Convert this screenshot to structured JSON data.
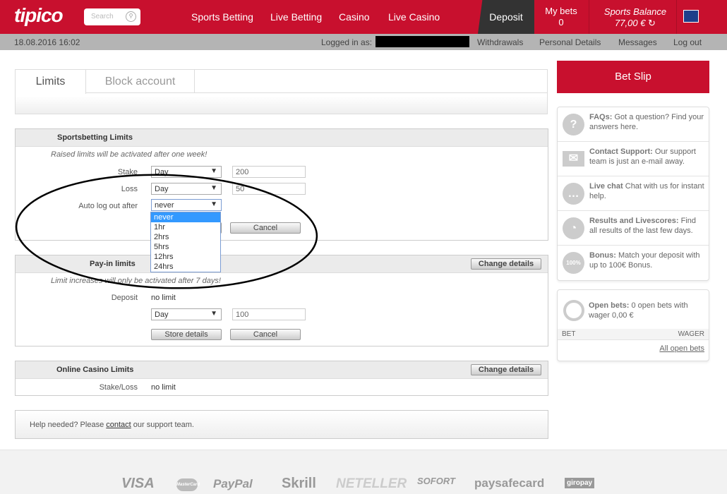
{
  "header": {
    "logo": "tipico",
    "search_placeholder": "Search",
    "nav": [
      "Sports Betting",
      "Live Betting",
      "Casino",
      "Live Casino"
    ],
    "deposit": "Deposit",
    "my_bets_label": "My bets",
    "my_bets_count": "0",
    "balance_label": "Sports Balance",
    "balance_value": "77,00 €",
    "brand_color": "#c8102e"
  },
  "subbar": {
    "datetime": "18.08.2016  16:02",
    "logged_in": "Logged in as:",
    "links": [
      "Withdrawals",
      "Personal Details",
      "Messages",
      "Log out"
    ]
  },
  "tabs": [
    "Limits",
    "Block account"
  ],
  "sportsbetting": {
    "title": "Sportsbetting Limits",
    "note": "Raised limits will be activated after one week!",
    "stake_label": "Stake",
    "stake_period": "Day",
    "stake_value": "200",
    "loss_label": "Loss",
    "loss_period": "Day",
    "loss_value": "50",
    "autologout_label": "Auto log out after",
    "autologout_value": "never",
    "options": [
      "never",
      "1hr",
      "2hrs",
      "5hrs",
      "12hrs",
      "24hrs"
    ],
    "cancel": "Cancel"
  },
  "payin": {
    "title": "Pay-in limits",
    "change": "Change details",
    "note": "Limit increases will only be activated after 7 days!",
    "deposit_label": "Deposit",
    "deposit_value": "no limit",
    "period": "Day",
    "amount": "100",
    "store": "Store details",
    "cancel": "Cancel"
  },
  "casino": {
    "title": "Online Casino Limits",
    "change": "Change details",
    "stake_label": "Stake/Loss",
    "stake_value": "no limit"
  },
  "help": {
    "pre": "Help needed? Please ",
    "link": "contact",
    "post": " our support team."
  },
  "sidebar": {
    "betslip": "Bet Slip",
    "items": [
      {
        "title": "FAQs:",
        "text": " Got a question? Find your answers here.",
        "icon": "?"
      },
      {
        "title": "Contact Support:",
        "text": " Our support team is just an e-mail away.",
        "icon": "✉"
      },
      {
        "title": "Live chat",
        "text": " Chat with us for instant help.",
        "icon": "…"
      },
      {
        "title": "Results and Livescores:",
        "text": " Find all results of the last few days.",
        "icon": "◔"
      },
      {
        "title": "Bonus:",
        "text": " Match your deposit with up to 100€ Bonus.",
        "icon": "100%"
      }
    ],
    "open_bets_title": "Open bets:",
    "open_bets_text": " 0 open bets with wager 0,00 €",
    "col_bet": "BET",
    "col_wager": "WAGER",
    "all_open": "All open bets"
  },
  "footer": {
    "payments": [
      "VISA",
      "MasterCard",
      "PayPal",
      "Skrill",
      "NETELLER",
      "SOFORT",
      "paysafecard",
      "giropay"
    ]
  }
}
